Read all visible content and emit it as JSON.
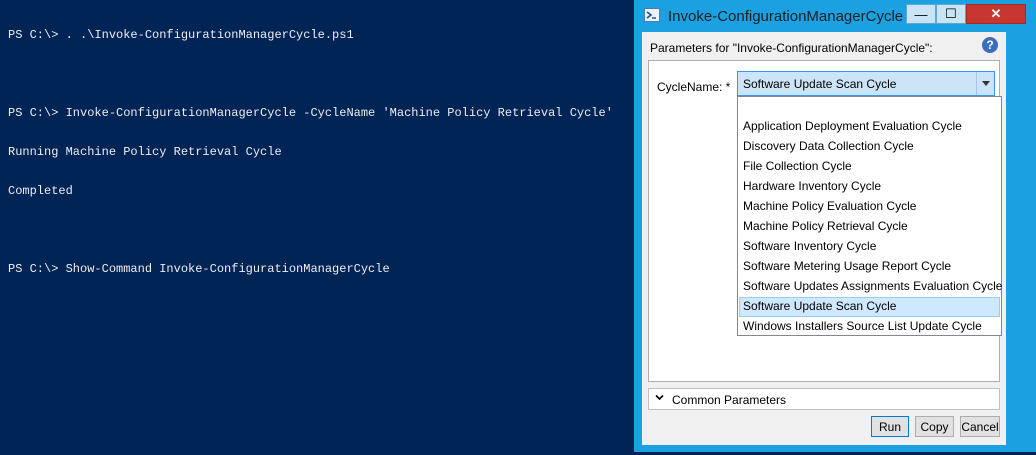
{
  "console": {
    "lines": [
      "PS C:\\> . .\\Invoke-ConfigurationManagerCycle.ps1",
      "",
      "PS C:\\> Invoke-ConfigurationManagerCycle -CycleName 'Machine Policy Retrieval Cycle'",
      "Running Machine Policy Retrieval Cycle",
      "Completed",
      "",
      "PS C:\\> Show-Command Invoke-ConfigurationManagerCycle"
    ]
  },
  "dialog": {
    "title": "Invoke-ConfigurationManagerCycle",
    "minimize_glyph": "—",
    "maximize_glyph": "☐",
    "close_glyph": "✕",
    "params_label": "Parameters for \"Invoke-ConfigurationManagerCycle\":",
    "help_glyph": "?",
    "cyclename_label": "CycleName: *",
    "selected_value": "Software Update Scan Cycle",
    "options": [
      "Application Deployment Evaluation Cycle",
      "Discovery Data Collection Cycle",
      "File Collection Cycle",
      "Hardware Inventory Cycle",
      "Machine Policy Evaluation Cycle",
      "Machine Policy Retrieval Cycle",
      "Software Inventory Cycle",
      "Software Metering Usage Report Cycle",
      "Software Updates Assignments Evaluation Cycle",
      "Software Update Scan Cycle",
      "Windows Installers Source List Update Cycle"
    ],
    "selected_index": 9,
    "common_parameters_label": "Common Parameters",
    "run_label": "Run",
    "copy_label": "Copy",
    "cancel_label": "Cancel"
  },
  "colors": {
    "console_bg": "#012456",
    "console_fg": "#eeedf0",
    "window_frame": "#1ba1e2",
    "selection_bg": "#cde8ff"
  },
  "icons": {
    "window_icon": "powershell-window-icon",
    "help": "help-icon",
    "dropdown": "chevron-down-icon",
    "common_expand": "chevron-down-icon"
  }
}
